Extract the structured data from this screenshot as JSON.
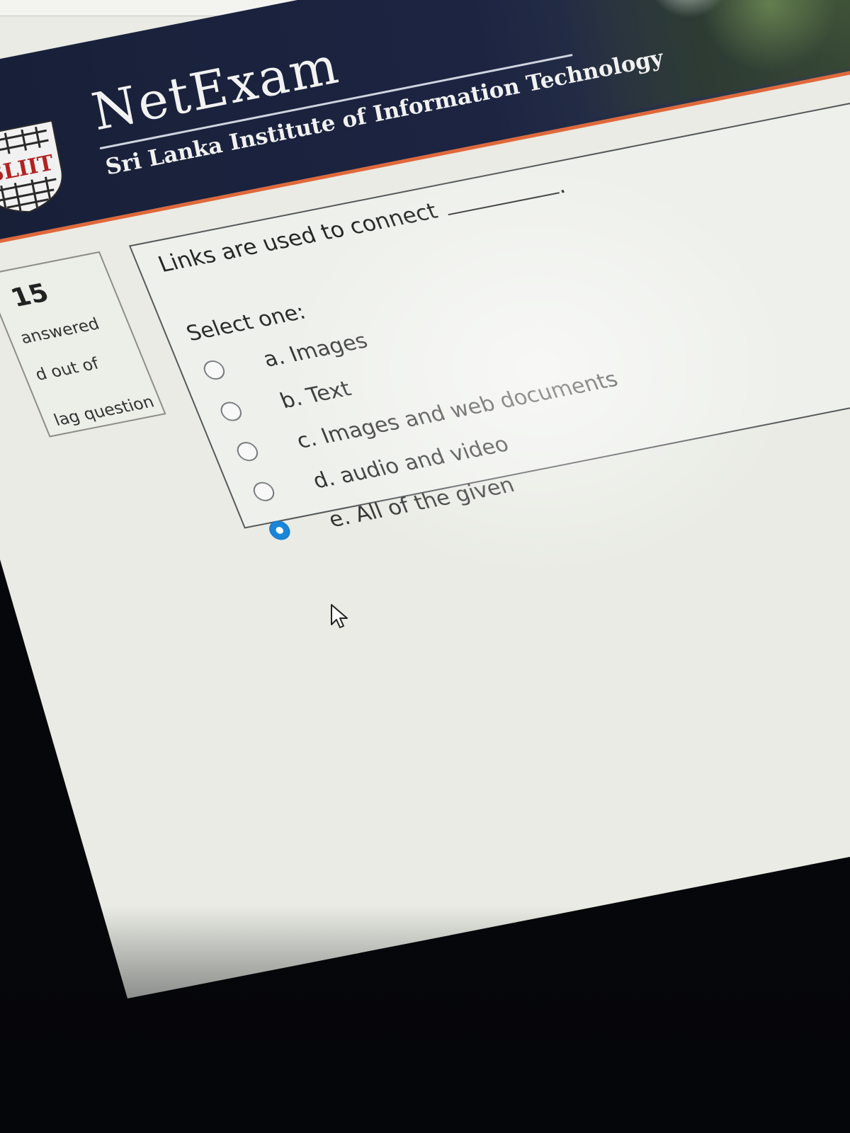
{
  "header": {
    "title": "NetExam",
    "subtitle": "Sri Lanka Institute of Information Technology",
    "logo_text": "SLIIT"
  },
  "nav": {
    "question_number": "15",
    "status": "answered",
    "mark": "d out of",
    "flag": "lag question"
  },
  "question": {
    "text": "Links are used to connect",
    "trailing": ".",
    "prompt": "Select one:",
    "options": [
      {
        "label": "a. Images",
        "selected": false
      },
      {
        "label": "b. Text",
        "selected": false
      },
      {
        "label": "c. Images and web documents",
        "selected": false
      },
      {
        "label": "d. audio and video",
        "selected": false
      },
      {
        "label": "e. All of the given",
        "selected": true
      }
    ]
  },
  "colors": {
    "header_bg": "#1c2442",
    "accent_stripe": "#e0683a",
    "radio_selected": "#1b86d8"
  },
  "icons": [
    "sliit-logo-icon",
    "radio-icon",
    "mouse-cursor-icon"
  ]
}
